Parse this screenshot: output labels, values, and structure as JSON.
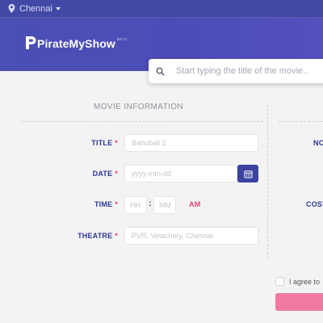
{
  "header": {
    "location": "Chennai",
    "brand": "PirateMyShow",
    "brand_badge": "BETA",
    "colors": {
      "top_bar": "#4248a6",
      "hero": "#4d4cb6"
    }
  },
  "search": {
    "placeholder": "Start typing the title of the movie.."
  },
  "movie_info": {
    "section_title": "MOVIE INFORMATION",
    "title_label": "TITLE",
    "title_placeholder": "Bahubali 2",
    "date_label": "DATE",
    "date_placeholder": "yyyy-mm-dd",
    "time_label": "TIME",
    "hour_placeholder": "HH",
    "time_separator": ":",
    "minute_placeholder": "MM",
    "meridiem": "AM",
    "theatre_label": "THEATRE",
    "theatre_placeholder": "PVR, Velachery, Chennai",
    "required_mark": "*"
  },
  "right_panel": {
    "label_1": "NO",
    "label_2": "COST",
    "agree_text": "I agree to"
  },
  "colors": {
    "accent": "#2e3796",
    "required": "#e0457b",
    "submit": "#f17aa3"
  }
}
